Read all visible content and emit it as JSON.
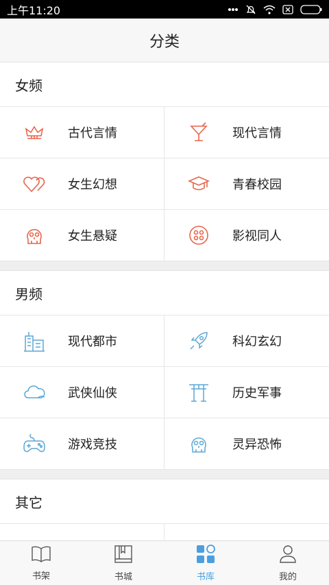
{
  "status": {
    "time": "上午11:20"
  },
  "header": {
    "title": "分类"
  },
  "sections": [
    {
      "title": "女频",
      "items": [
        {
          "label": "古代言情",
          "icon": "crown-icon"
        },
        {
          "label": "现代言情",
          "icon": "cocktail-icon"
        },
        {
          "label": "女生幻想",
          "icon": "hearts-icon"
        },
        {
          "label": "青春校园",
          "icon": "graduation-cap-icon"
        },
        {
          "label": "女生悬疑",
          "icon": "skull-icon"
        },
        {
          "label": "影视同人",
          "icon": "film-reel-icon"
        }
      ]
    },
    {
      "title": "男频",
      "items": [
        {
          "label": "现代都市",
          "icon": "city-buildings-icon"
        },
        {
          "label": "科幻玄幻",
          "icon": "rocket-icon"
        },
        {
          "label": "武侠仙侠",
          "icon": "cloud-icon"
        },
        {
          "label": "历史军事",
          "icon": "gate-icon"
        },
        {
          "label": "游戏竞技",
          "icon": "gamepad-icon"
        },
        {
          "label": "灵异恐怖",
          "icon": "skull-icon"
        }
      ]
    },
    {
      "title": "其它"
    }
  ],
  "tabbar": {
    "tabs": [
      {
        "label": "书架",
        "icon": "open-book-icon"
      },
      {
        "label": "书城",
        "icon": "book-icon"
      },
      {
        "label": "书库",
        "icon": "grid-icon",
        "active": true
      },
      {
        "label": "我的",
        "icon": "user-icon"
      }
    ]
  },
  "colors": {
    "female_accent": "#e8654b",
    "male_accent": "#5aa7d6",
    "tab_active": "#4a9fe0"
  }
}
